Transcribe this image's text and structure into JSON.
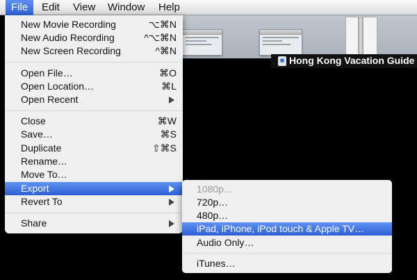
{
  "menubar": {
    "items": [
      "File",
      "Edit",
      "View",
      "Window",
      "Help"
    ],
    "active_index": 0
  },
  "window": {
    "title": "Hong Kong Vacation Guide"
  },
  "file_menu": {
    "items": [
      {
        "label": "New Movie Recording",
        "shortcut": "⌥⌘N"
      },
      {
        "label": "New Audio Recording",
        "shortcut": "^⌥⌘N"
      },
      {
        "label": "New Screen Recording",
        "shortcut": "^⌘N"
      },
      {
        "label": "Open File…",
        "shortcut": "⌘O"
      },
      {
        "label": "Open Location…",
        "shortcut": "⌘L"
      },
      {
        "label": "Open Recent",
        "shortcut": ""
      },
      {
        "label": "Close",
        "shortcut": "⌘W"
      },
      {
        "label": "Save…",
        "shortcut": "⌘S"
      },
      {
        "label": "Duplicate",
        "shortcut": "⇧⌘S"
      },
      {
        "label": "Rename…",
        "shortcut": ""
      },
      {
        "label": "Move To…",
        "shortcut": ""
      },
      {
        "label": "Export",
        "shortcut": ""
      },
      {
        "label": "Revert To",
        "shortcut": ""
      },
      {
        "label": "Share",
        "shortcut": ""
      }
    ],
    "highlighted": "Export"
  },
  "export_submenu": {
    "items": [
      {
        "label": "1080p…",
        "enabled": false
      },
      {
        "label": "720p…",
        "enabled": true
      },
      {
        "label": "480p…",
        "enabled": true
      },
      {
        "label": "iPad, iPhone, iPod touch & Apple TV…",
        "enabled": true
      },
      {
        "label": "Audio Only…",
        "enabled": true
      },
      {
        "label": "iTunes…",
        "enabled": true
      }
    ],
    "highlighted": "iPad, iPhone, iPod touch & Apple TV…"
  },
  "colors": {
    "highlight": "#2e60d6",
    "disabled_text": "#9a9a9a"
  }
}
